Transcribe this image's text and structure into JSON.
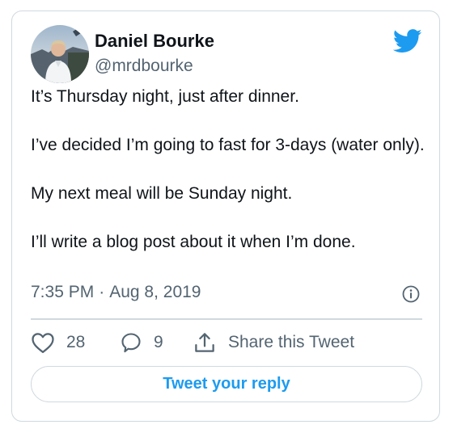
{
  "author": {
    "name": "Daniel Bourke",
    "handle": "@mrdbourke",
    "avatar_icon": "profile-photo"
  },
  "tweet": {
    "paragraphs": [
      "It’s Thursday night, just after dinner.",
      "I’ve decided I’m going to fast for 3-days (water only).",
      "My next meal will be Sunday night.",
      "I’ll write a blog post about it when I’m done."
    ],
    "time": "7:35 PM",
    "separator": "·",
    "date": "Aug 8, 2019"
  },
  "actions": {
    "like_count": "28",
    "reply_count": "9",
    "share_label": "Share this Tweet"
  },
  "reply_button": {
    "label": "Tweet your reply"
  },
  "colors": {
    "brand_blue": "#1d9bf0",
    "text": "#0f1419",
    "secondary_text": "#536471",
    "border": "#cfd9de"
  },
  "icons": [
    "twitter-bird-icon",
    "info-icon",
    "heart-icon",
    "reply-icon",
    "share-icon"
  ]
}
